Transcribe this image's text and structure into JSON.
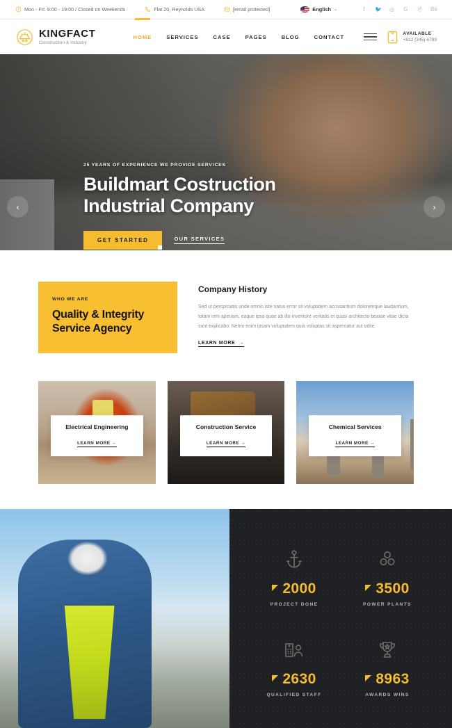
{
  "topbar": {
    "items": [
      {
        "icon": "clock-icon",
        "text": "Mon - Fri: 9:00 - 19:00 / Closed on Weekends"
      },
      {
        "icon": "phone-icon",
        "text": "Flat 20, Reynolds USA"
      },
      {
        "icon": "envelope-icon",
        "text": "[email protected]"
      }
    ],
    "language": {
      "label": "English",
      "caret": "⌄",
      "flag": "us-flag-icon"
    },
    "socials": [
      {
        "name": "facebook-icon",
        "glyph": "f"
      },
      {
        "name": "twitter-icon",
        "glyph": "🐦"
      },
      {
        "name": "instagram-icon",
        "glyph": "◎"
      },
      {
        "name": "google-icon",
        "glyph": "G"
      },
      {
        "name": "pinterest-icon",
        "glyph": "Ⓟ"
      },
      {
        "name": "behance-icon",
        "glyph": "Bē"
      }
    ]
  },
  "header": {
    "brand_name": "KINGFACT",
    "brand_tagline": "Construction & Industry",
    "nav": [
      {
        "label": "HOME",
        "active": true
      },
      {
        "label": "SERVICES",
        "active": false
      },
      {
        "label": "CASE",
        "active": false
      },
      {
        "label": "PAGES",
        "active": false
      },
      {
        "label": "BLOG",
        "active": false
      },
      {
        "label": "CONTACT",
        "active": false
      }
    ],
    "available_title": "AVAILABLE",
    "available_phone": "+812 (345) 6789"
  },
  "hero": {
    "kicker": "25 YEARS OF EXPERIENCE WE PROVIDE SERVICES",
    "title_line1": "Buildmart Costruction",
    "title_line2": "Industrial Company",
    "primary_cta": "GET STARTED",
    "secondary_cta": "OUR SERVICES",
    "prev_arrow": "‹",
    "next_arrow": "›"
  },
  "about": {
    "kicker": "WHO WE ARE",
    "headline_line1": "Quality & Integrity",
    "headline_line2": "Service Agency",
    "section_title": "Company History",
    "body": "Sed ut perspiciatis unde omnis iste natus error sit voluptatem accusantium doloremque laudantium, totam rem aperiam, eaque ipsa quae ab illo inventore veritatis et quasi architecto beatae vitae dicta sunt explicabo. Nemo enim ipsam voluptatem quia voluptas sit aspernatur aut odite.",
    "learn_more": "LEARN MORE",
    "learn_more_arrow": "→"
  },
  "cards": [
    {
      "title": "Electrical Engineering",
      "link": "LEARN MORE",
      "arrow": "→"
    },
    {
      "title": "Construction Service",
      "link": "LEARN MORE",
      "arrow": "→"
    },
    {
      "title": "Chemical Services",
      "link": "LEARN MORE",
      "arrow": "→"
    }
  ],
  "stats": [
    {
      "icon": "anchor-icon",
      "value": "2000",
      "label": "PROJECT DONE"
    },
    {
      "icon": "molecule-circles-icon",
      "value": "3500",
      "label": "POWER PLANTS"
    },
    {
      "icon": "building-person-icon",
      "value": "2630",
      "label": "QUALIFIED STAFF"
    },
    {
      "icon": "trophy-icon",
      "value": "8963",
      "label": "AWARDS WINS"
    }
  ],
  "colors": {
    "accent": "#f5bc2f",
    "accent_card": "#f8bf33",
    "dark_panel": "#1f2023",
    "text_dark": "#1b1b1b",
    "text_muted": "#8b8b8b"
  }
}
